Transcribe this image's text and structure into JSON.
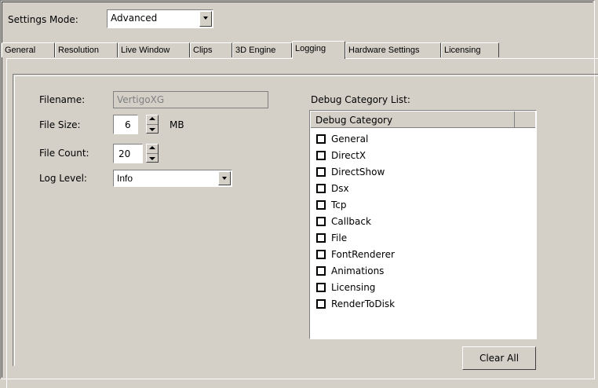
{
  "settings_mode": {
    "label": "Settings Mode:",
    "value": "Advanced"
  },
  "tabs": [
    {
      "label": "General"
    },
    {
      "label": "Resolution"
    },
    {
      "label": "Live Window"
    },
    {
      "label": "Clips"
    },
    {
      "label": "3D Engine"
    },
    {
      "label": "Logging"
    },
    {
      "label": "Hardware Settings"
    },
    {
      "label": "Licensing"
    }
  ],
  "active_tab": "Logging",
  "logging": {
    "filename_label": "Filename:",
    "filename_value": "VertigoXG",
    "filesize_label": "File Size:",
    "filesize_value": "6",
    "filesize_unit": "MB",
    "filecount_label": "File Count:",
    "filecount_value": "20",
    "loglevel_label": "Log Level:",
    "loglevel_value": "Info"
  },
  "debug": {
    "list_label": "Debug Category List:",
    "column_header": "Debug Category",
    "items": [
      {
        "label": "General",
        "checked": false
      },
      {
        "label": "DirectX",
        "checked": false
      },
      {
        "label": "DirectShow",
        "checked": false
      },
      {
        "label": "Dsx",
        "checked": false
      },
      {
        "label": "Tcp",
        "checked": false
      },
      {
        "label": "Callback",
        "checked": false
      },
      {
        "label": "File",
        "checked": false
      },
      {
        "label": "FontRenderer",
        "checked": false
      },
      {
        "label": "Animations",
        "checked": false
      },
      {
        "label": "Licensing",
        "checked": false
      },
      {
        "label": "RenderToDisk",
        "checked": false
      }
    ],
    "clear_all_label": "Clear All"
  }
}
